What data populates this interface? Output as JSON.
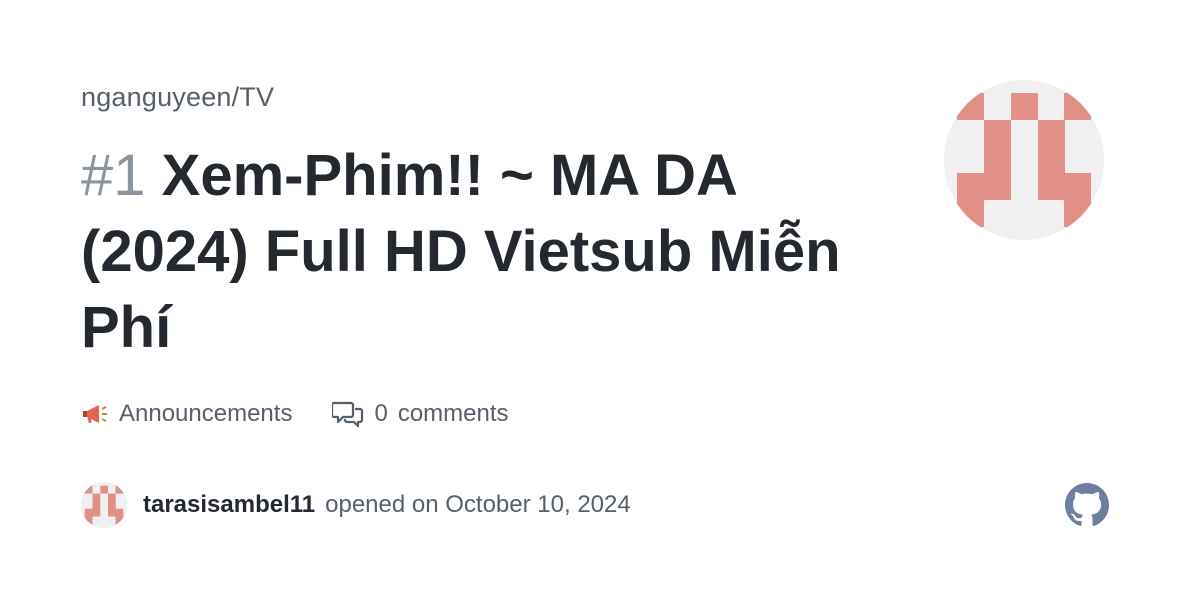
{
  "repo": "nganguyeen/TV",
  "issue": {
    "number": "#1",
    "title": "Xem-Phim!! ~ MA DA (2024) Full HD Vietsub Miễn Phí"
  },
  "meta": {
    "category": "Announcements",
    "category_icon": "megaphone-icon",
    "comment_count": "0",
    "comments_label": "comments"
  },
  "author": {
    "username": "tarasisambel11",
    "action": "opened on October 10, 2024"
  },
  "colors": {
    "avatar_pink": "#e09086",
    "avatar_bg": "#f0f0f0",
    "github_logo": "#6e7f9e"
  }
}
